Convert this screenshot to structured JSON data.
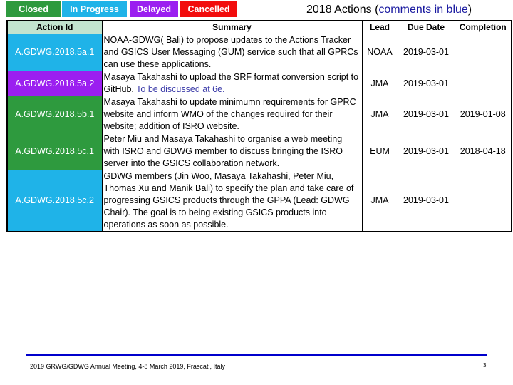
{
  "legend": [
    {
      "label": "Closed",
      "color": "#2e9a3e"
    },
    {
      "label": "In Progress",
      "color": "#1fb3e8"
    },
    {
      "label": "Delayed",
      "color": "#9b1ff0"
    },
    {
      "label": "Cancelled",
      "color": "#f20d0d"
    }
  ],
  "title": {
    "main": "2018 Actions (",
    "comment": "comments in blue",
    "close": ")"
  },
  "table": {
    "headers": [
      "Action Id",
      "Summary",
      "Lead",
      "Due Date",
      "Completion"
    ],
    "rows": [
      {
        "id": "A.GDWG.2018.5a.1",
        "status_color": "#1fb3e8",
        "summary": "NOAA-GDWG( Bali) to propose updates to the Actions Tracker and GSICS User Messaging (GUM) service such that all GPRCs can use these applications.",
        "comment": "",
        "lead": "NOAA",
        "due": "2019-03-01",
        "completion": ""
      },
      {
        "id": "A.GDWG.2018.5a.2",
        "status_color": "#9b1ff0",
        "summary": "Masaya Takahashi to upload the SRF format conversion script to GitHub.",
        "comment": "To be discussed at 6e.",
        "lead": "JMA",
        "due": "2019-03-01",
        "completion": ""
      },
      {
        "id": "A.GDWG.2018.5b.1",
        "status_color": "#2e9a3e",
        "summary": "Masaya Takahashi to update minimumn requirements for GPRC website and inform WMO of the changes required for their website; addition of ISRO website.",
        "comment": "",
        "lead": "JMA",
        "due": "2019-03-01",
        "completion": "2019-01-08"
      },
      {
        "id": "A.GDWG.2018.5c.1",
        "status_color": "#2e9a3e",
        "summary": "Peter Miu and Masaya Takahashi to organise a web meeting with ISRO and GDWG member to discuss bringing the ISRO server into the GSICS collaboration network.",
        "comment": "",
        "lead": "EUM",
        "due": "2019-03-01",
        "completion": "2018-04-18"
      },
      {
        "id": "A.GDWG.2018.5c.2",
        "status_color": "#1fb3e8",
        "summary": "GDWG members (Jin Woo, Masaya Takahashi, Peter Miu, Thomas Xu and Manik Bali) to specify the plan and take care of progressing GSICS products through the GPPA (Lead: GDWG Chair). The goal is to being existing GSICS products into operations as soon as possible.",
        "comment": "",
        "lead": "JMA",
        "due": "2019-03-01",
        "completion": ""
      }
    ]
  },
  "footer": {
    "text": "2019 GRWG/GDWG Annual Meeting, 4-8 March 2019, Frascati, Italy",
    "page": "3",
    "line_color": "#0000cc"
  }
}
